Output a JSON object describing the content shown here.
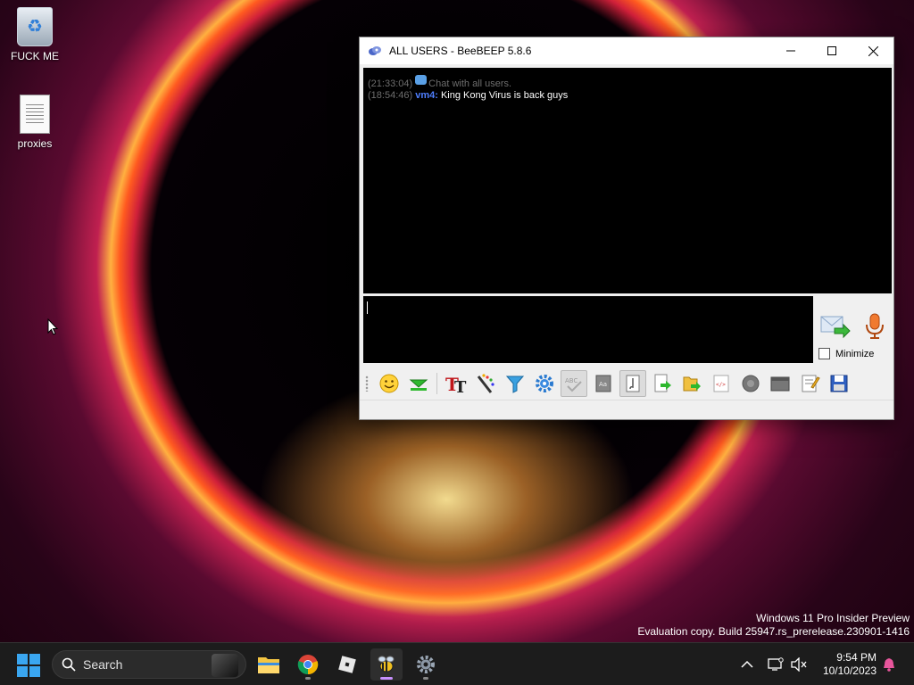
{
  "desktop": {
    "icons": [
      {
        "label": "FUCK ME",
        "icon": "recycle-bin-icon"
      },
      {
        "label": "proxies",
        "icon": "text-file-icon"
      }
    ],
    "watermark": {
      "line1": "Windows 11 Pro Insider Preview",
      "line2": "Evaluation copy. Build 25947.rs_prerelease.230901-1416"
    }
  },
  "window": {
    "title": "ALL USERS - BeeBEEP 5.8.6",
    "controls": {
      "minimize": "—",
      "maximize": "☐",
      "close": "✕"
    },
    "messages": [
      {
        "time": "(21:33:04)",
        "user": "",
        "text": "Chat with all users.",
        "system": true
      },
      {
        "time": "(18:54:46)",
        "user": "vm4:",
        "text": "King Kong Virus is back guys",
        "system": false
      }
    ],
    "minimize_label": "Minimize",
    "minimize_checked": false,
    "toolbar": [
      "emoticons-icon",
      "unread-icon",
      "font-icon",
      "color-icon",
      "filter-icon",
      "settings-icon",
      "spellcheck-icon",
      "dictionary-icon",
      "compact-icon",
      "send-file-icon",
      "send-folder-icon",
      "html-icon",
      "record-icon",
      "screenshot-icon",
      "notes-icon",
      "save-chat-icon"
    ]
  },
  "taskbar": {
    "search_label": "Search",
    "apps": [
      "file-explorer-icon",
      "chrome-icon",
      "roblox-icon",
      "beebeep-icon",
      "settings-gear-icon"
    ],
    "clock": {
      "time": "9:54 PM",
      "date": "10/10/2023"
    }
  },
  "colors": {
    "accent": "#4f7fff",
    "taskbar": "#1c1c1c",
    "start": "#3aa6f0"
  }
}
